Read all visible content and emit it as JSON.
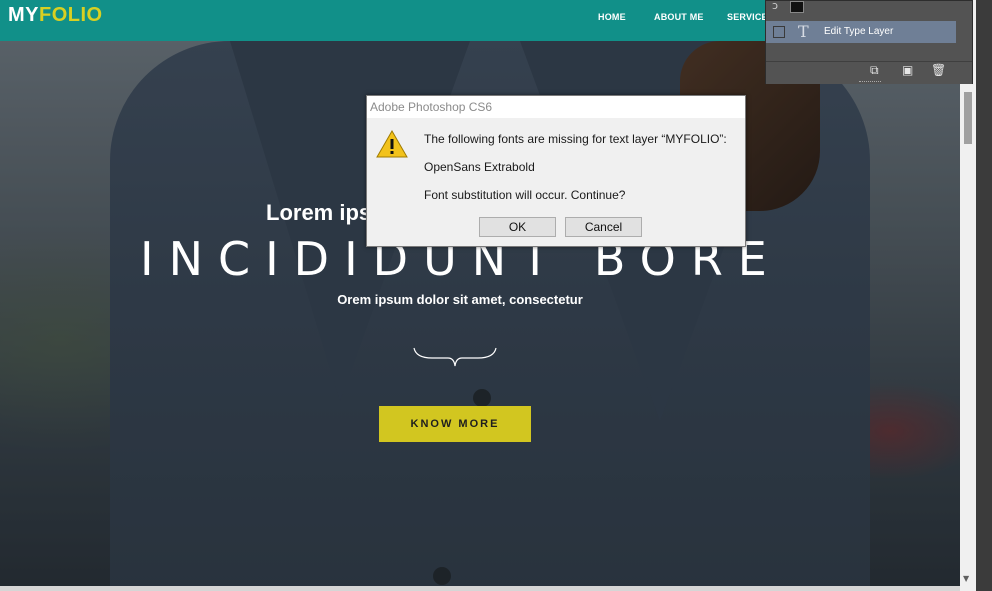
{
  "website": {
    "logo_my": "MY",
    "logo_folio": "FOLIO",
    "nav": [
      "HOME",
      "ABOUT ME",
      "SERVICES"
    ],
    "hero": {
      "subtitle": "Lorem ips",
      "title": "INCIDIDUNT BORE",
      "tagline": "Orem ipsum dolor sit amet, consectetur",
      "cta_label": "KNOW MORE"
    },
    "colors": {
      "navbar": "#119089",
      "logo_accent": "#d8d022",
      "cta": "#d2c620"
    }
  },
  "photoshop_layers_panel": {
    "layer_name": "Edit Type Layer",
    "layer_type_icon": "T",
    "bottom_icons": [
      "new-layer-icon",
      "camera-icon",
      "trash-icon"
    ]
  },
  "dialog": {
    "title": "Adobe Photoshop CS6",
    "line1": "The following fonts are missing for text layer “MYFOLIO”:",
    "line2": "OpenSans Extrabold",
    "line3": "Font substitution will occur. Continue?",
    "ok_label": "OK",
    "cancel_label": "Cancel",
    "icon": "warning-icon"
  }
}
